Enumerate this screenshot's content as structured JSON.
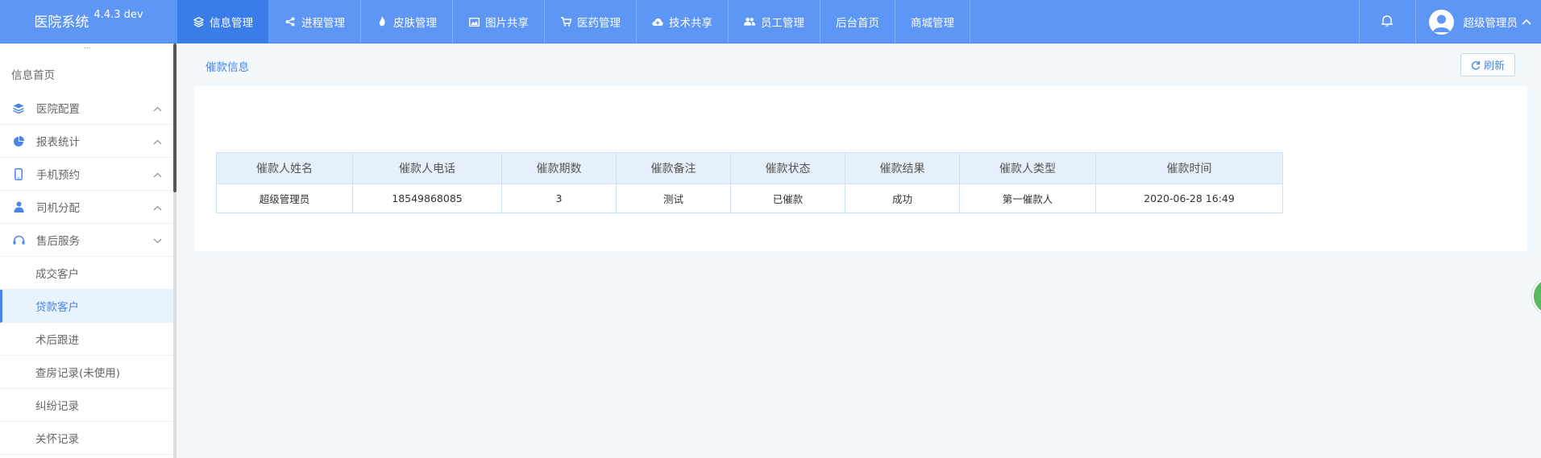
{
  "app": {
    "name": "医院系统",
    "version": "4.4.3 dev"
  },
  "nav": [
    {
      "label": "信息管理",
      "icon": "cube-icon",
      "active": true
    },
    {
      "label": "进程管理",
      "icon": "share-icon",
      "active": false
    },
    {
      "label": "皮肤管理",
      "icon": "flame-icon",
      "active": false
    },
    {
      "label": "图片共享",
      "icon": "image-icon",
      "active": false
    },
    {
      "label": "医药管理",
      "icon": "cart-icon",
      "active": false
    },
    {
      "label": "技术共享",
      "icon": "cloud-upload-icon",
      "active": false
    },
    {
      "label": "员工管理",
      "icon": "users-icon",
      "active": false
    },
    {
      "label": "后台首页",
      "icon": "",
      "active": false
    },
    {
      "label": "商城管理",
      "icon": "",
      "active": false
    }
  ],
  "user": {
    "name": "超级管理员"
  },
  "sidebar": {
    "dots": "···",
    "home": "信息首页",
    "menus": [
      {
        "label": "医院配置",
        "icon": "layers-icon"
      },
      {
        "label": "报表统计",
        "icon": "pie-chart-icon"
      },
      {
        "label": "手机预约",
        "icon": "mobile-icon"
      },
      {
        "label": "司机分配",
        "icon": "driver-icon"
      },
      {
        "label": "售后服务",
        "icon": "support-icon"
      }
    ],
    "submenu": [
      {
        "label": "成交客户"
      },
      {
        "label": "贷款客户",
        "selected": true
      },
      {
        "label": "术后跟进"
      },
      {
        "label": "查房记录(未使用)"
      },
      {
        "label": "纠纷记录"
      },
      {
        "label": "关怀记录"
      }
    ]
  },
  "content": {
    "breadcrumb": "催款信息",
    "refresh_label": "刷新",
    "table": {
      "headers": [
        "催款人姓名",
        "催款人电话",
        "催款期数",
        "催款备注",
        "催款状态",
        "催款结果",
        "催款人类型",
        "催款时间"
      ],
      "rows": [
        [
          "超级管理员",
          "18549868085",
          "3",
          "测试",
          "已催款",
          "成功",
          "第一催款人",
          "2020-06-28 16:49"
        ]
      ]
    }
  },
  "colors": {
    "topbar": "#5d96f4",
    "active_nav": "#3a7de9",
    "accent": "#4a86e8"
  }
}
